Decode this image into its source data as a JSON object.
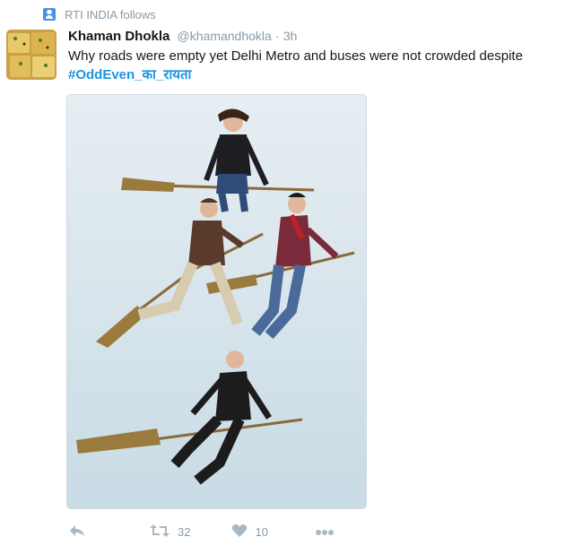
{
  "context": {
    "text": "RTI INDIA follows"
  },
  "tweet": {
    "author_name": "Khaman Dhokla",
    "author_handle": "@khamandhokla",
    "separator": "·",
    "time": "3h",
    "text": "Why roads were empty yet Delhi Metro and buses were not crowded despite",
    "hashtag": "#OddEven_का_रायता"
  },
  "actions": {
    "retweet_count": "32",
    "like_count": "10"
  },
  "icons": [
    "person-icon",
    "reply-icon",
    "retweet-icon",
    "heart-icon",
    "more-icon"
  ],
  "colors": {
    "link": "#1b95e0",
    "muted": "#8899a6",
    "icon": "#aab8c2"
  }
}
